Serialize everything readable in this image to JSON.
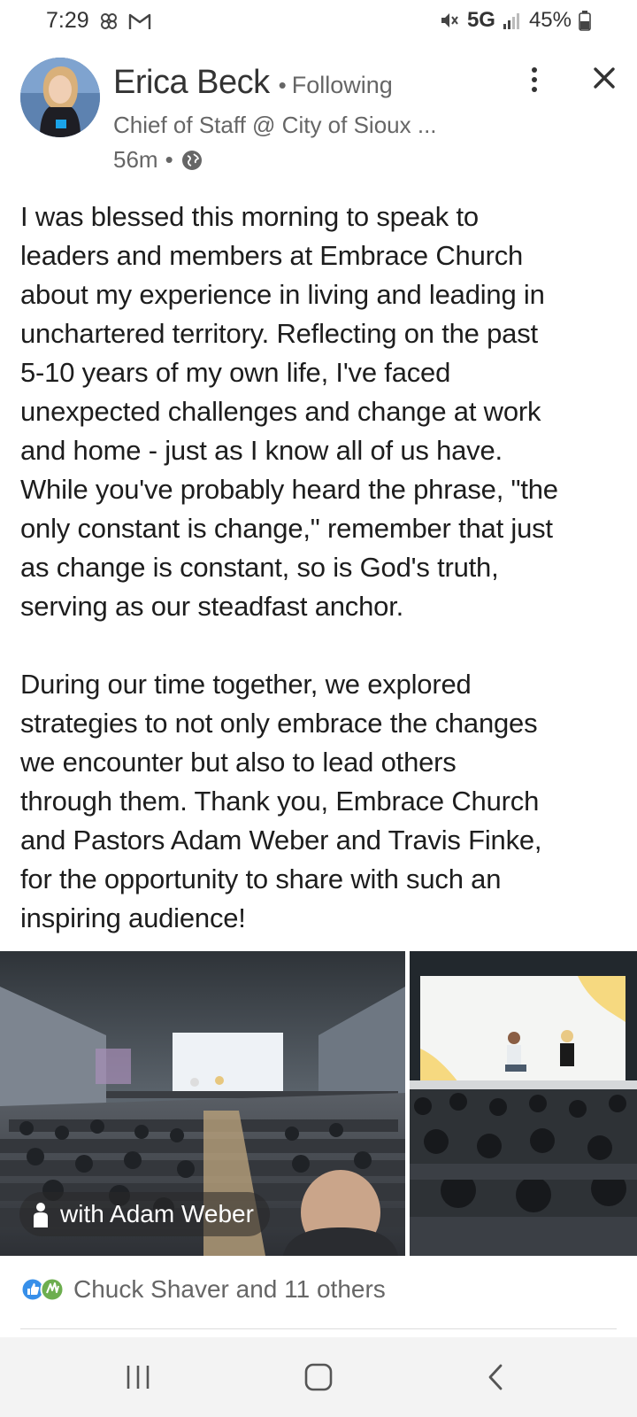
{
  "status_bar": {
    "time": "7:29",
    "network": "5G",
    "battery": "45%",
    "icons": [
      "pinwheel-icon",
      "gmail-icon",
      "mute-icon",
      "signal-icon",
      "battery-icon"
    ]
  },
  "post": {
    "author_name": "Erica Beck",
    "follow_status": "Following",
    "author_headline": "Chief of Staff @ City of Sioux ...",
    "timestamp": "56m",
    "visibility_icon": "globe-icon",
    "body": "I was blessed this morning to speak to\nleaders and members at Embrace Church\nabout my experience in living and leading in\nunchartered territory.  Reflecting on the past\n5-10 years of my own life, I've faced\nunexpected challenges and change at work\nand home - just as I know all of us have.\nWhile you've probably heard the phrase, \"the\nonly constant is change,\" remember that just\nas change is constant, so is God's truth,\nserving as our steadfast anchor.\n\nDuring our time together, we explored\nstrategies to not only embrace the changes\nwe encounter but also to lead others\nthrough them.  Thank you, Embrace Church\nand Pastors Adam Weber and Travis Finke,\nfor the opportunity to share with such an\ninspiring audience!",
    "photo_tag": "with Adam Weber",
    "reactions_text": "Chuck Shaver and 11 others"
  },
  "colors": {
    "text_primary": "#1d1d1d",
    "text_secondary": "#666666",
    "like_blue": "#378fe9",
    "celebrate_green": "#44712e"
  },
  "nav_bar": {
    "icons": [
      "recents-icon",
      "home-icon",
      "back-icon"
    ]
  }
}
